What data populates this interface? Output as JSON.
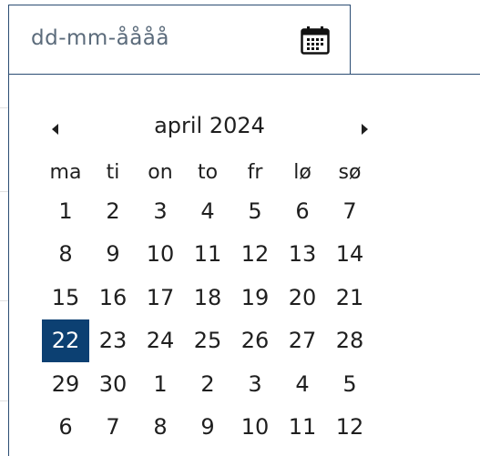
{
  "input": {
    "placeholder": "dd-mm-åååå",
    "icon": "calendar-icon"
  },
  "calendar": {
    "month_title": "april 2024",
    "prev_icon": "triangle-left-icon",
    "next_icon": "triangle-right-icon",
    "weekdays": [
      "ma",
      "ti",
      "on",
      "to",
      "fr",
      "lø",
      "sø"
    ],
    "weeks": [
      [
        "1",
        "2",
        "3",
        "4",
        "5",
        "6",
        "7"
      ],
      [
        "8",
        "9",
        "10",
        "11",
        "12",
        "13",
        "14"
      ],
      [
        "15",
        "16",
        "17",
        "18",
        "19",
        "20",
        "21"
      ],
      [
        "22",
        "23",
        "24",
        "25",
        "26",
        "27",
        "28"
      ],
      [
        "29",
        "30",
        "1",
        "2",
        "3",
        "4",
        "5"
      ],
      [
        "6",
        "7",
        "8",
        "9",
        "10",
        "11",
        "12"
      ]
    ],
    "selected_day": "22",
    "colors": {
      "border": "#2b4c73",
      "selected_bg": "#0c4072",
      "selected_text": "#ffffff",
      "placeholder_text": "#5b6b7b"
    }
  }
}
